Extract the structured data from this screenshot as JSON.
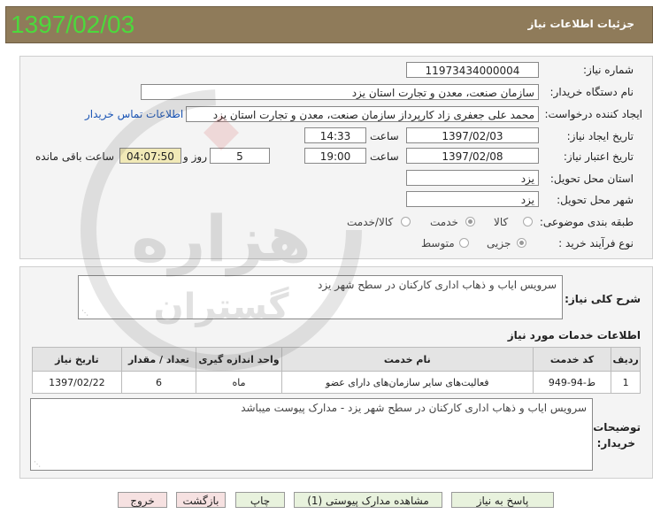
{
  "stamp": "1397/02/03",
  "header": {
    "title": "جزئیات اطلاعات نیاز"
  },
  "labels": {
    "need_number": "شماره نیاز:",
    "buyer_org": "نام دستگاه خریدار:",
    "requester": "ایجاد کننده درخواست:",
    "created_date": "تاریخ ایجاد نیاز:",
    "validity_date": "تاریخ اعتبار نیاز:",
    "hour": "ساعت",
    "day_and": "روز و",
    "remaining": "ساعت باقی مانده",
    "province": "استان محل تحویل:",
    "city": "شهر محل تحویل:",
    "category": "طبقه بندی موضوعی:",
    "process": "نوع فرآیند خرید :",
    "description": "شرح کلی نیاز:",
    "services_title": "اطلاعات خدمات مورد نیاز",
    "buyer_notes_1": "توضیحات",
    "buyer_notes_2": "خریدار:"
  },
  "fields": {
    "need_number": "11973434000004",
    "buyer_org": "سازمان صنعت، معدن و تجارت استان یزد",
    "requester": "محمد علی جعفری زاد کارپرداز سازمان صنعت، معدن و تجارت استان یزد",
    "contact_link": "اطلاعات تماس خریدار",
    "created_date": "1397/02/03",
    "created_time": "14:33",
    "validity_date": "1397/02/08",
    "validity_time": "19:00",
    "days": "5",
    "remaining_time": "04:07:50",
    "province": "یزد",
    "city": "یزد",
    "description": "سرویس ایاب و ذهاب اداری کارکنان در سطح شهر یزد",
    "buyer_notes": "سرویس ایاب و ذهاب اداری کارکنان در سطح شهر یزد - مدارک پیوست میباشد"
  },
  "category_options": [
    {
      "label": "کالا",
      "selected": false
    },
    {
      "label": "خدمت",
      "selected": true
    },
    {
      "label": "کالا/خدمت",
      "selected": false
    }
  ],
  "process_options": [
    {
      "label": "جزیی",
      "selected": true
    },
    {
      "label": "متوسط",
      "selected": false
    }
  ],
  "table": {
    "headers": [
      "ردیف",
      "کد خدمت",
      "نام خدمت",
      "واحد اندازه گیری",
      "تعداد / مقدار",
      "تاریخ نیاز"
    ],
    "rows": [
      [
        "1",
        "ط-94-949",
        "فعالیت‌های سایر سازمان‌های دارای عضو",
        "ماه",
        "6",
        "1397/02/22"
      ]
    ]
  },
  "buttons": {
    "reply": "پاسخ به نیاز",
    "attachments": "مشاهده مدارک پیوستی (1)",
    "print": "چاپ",
    "back": "بازگشت",
    "exit": "خروج"
  },
  "watermark": {
    "word1": "هزاره",
    "word2": "گستران"
  }
}
